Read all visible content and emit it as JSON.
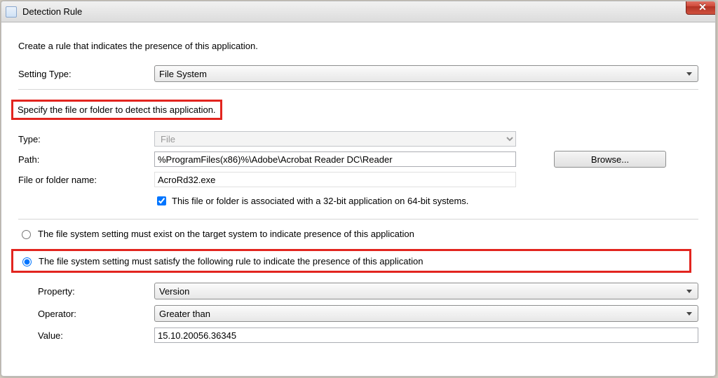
{
  "window": {
    "title": "Detection Rule"
  },
  "intro": "Create a rule that indicates the presence of this application.",
  "settingType": {
    "label": "Setting Type:",
    "value": "File System"
  },
  "sectionHeading": "Specify the file or folder to detect this application.",
  "type": {
    "label": "Type:",
    "value": "File"
  },
  "path": {
    "label": "Path:",
    "value": "%ProgramFiles(x86)%\\Adobe\\Acrobat Reader DC\\Reader",
    "browse": "Browse..."
  },
  "fileOrFolder": {
    "label": "File or folder name:",
    "value": "AcroRd32.exe"
  },
  "assoc32": {
    "label": "This file or folder is associated with a 32-bit application on 64-bit systems.",
    "checked": true
  },
  "radios": {
    "exists": "The file system setting must exist on the target system to indicate presence of this application",
    "satisfy": "The file system setting must satisfy the following rule to indicate the presence of this application"
  },
  "rule": {
    "propertyLabel": "Property:",
    "propertyValue": "Version",
    "operatorLabel": "Operator:",
    "operatorValue": "Greater than",
    "valueLabel": "Value:",
    "valueValue": "15.10.20056.36345"
  }
}
